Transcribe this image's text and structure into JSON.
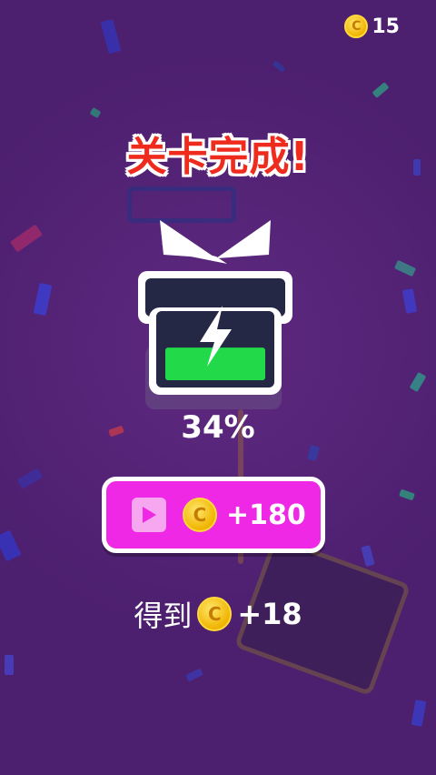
{
  "currency": {
    "icon": "coin-icon",
    "coin_symbol": "C",
    "amount": "15"
  },
  "title": "关卡完成!",
  "battery": {
    "icon": "lightning-bolt-icon",
    "fill_fraction": 0.34
  },
  "progress_text": "34%",
  "video_reward": {
    "icon": "play-icon",
    "amount": "+180"
  },
  "earn": {
    "label": "得到",
    "amount": "+18"
  },
  "colors": {
    "background": "#4d1f6f",
    "title_red": "#ee2b1c",
    "button_magenta": "#ee28e4",
    "battery_green": "#22d94a",
    "gift_navy": "#242845"
  }
}
